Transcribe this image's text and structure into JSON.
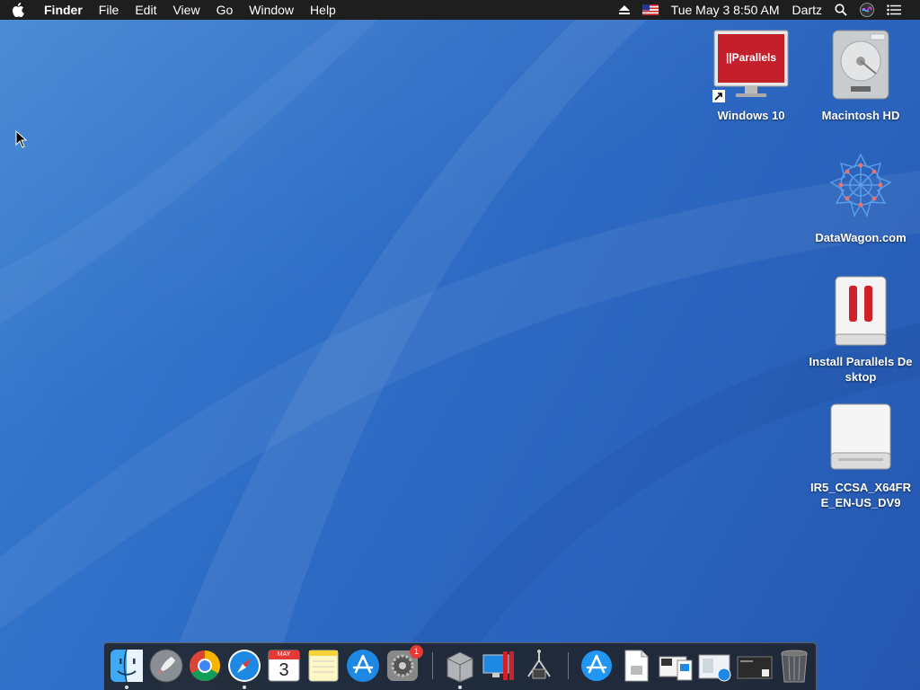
{
  "menubar": {
    "app_name": "Finder",
    "menus": [
      "File",
      "Edit",
      "View",
      "Go",
      "Window",
      "Help"
    ],
    "clock": "Tue May 3  8:50 AM",
    "user": "Dartz"
  },
  "desktop": {
    "icons": [
      {
        "label": "Windows 10",
        "icon": "parallels-vm-icon",
        "brand": "||Parallels"
      },
      {
        "label": "Macintosh HD",
        "icon": "hard-drive-icon"
      },
      {
        "label": "DataWagon.com",
        "icon": "datawagon-icon"
      },
      {
        "label": "Install Parallels Desktop",
        "icon": "parallels-installer-icon"
      },
      {
        "label": "IR5_CCSA_X64FRE_EN-US_DV9",
        "icon": "disk-image-icon"
      }
    ]
  },
  "dock": {
    "apps": [
      {
        "name": "Finder",
        "icon": "finder-icon",
        "running": true
      },
      {
        "name": "Launchpad",
        "icon": "launchpad-icon"
      },
      {
        "name": "Google Chrome",
        "icon": "chrome-icon"
      },
      {
        "name": "Safari",
        "icon": "safari-icon",
        "running": true
      },
      {
        "name": "Calendar",
        "icon": "calendar-icon",
        "month": "MAY",
        "day": "3"
      },
      {
        "name": "Notes",
        "icon": "notes-icon"
      },
      {
        "name": "App Store",
        "icon": "app-store-icon"
      },
      {
        "name": "System Preferences",
        "icon": "system-preferences-icon",
        "badge": "1"
      },
      {
        "name": "Boot Camp Assistant",
        "icon": "boot-camp-icon",
        "running": true
      },
      {
        "name": "Parallels Desktop",
        "icon": "parallels-desktop-icon"
      },
      {
        "name": "Network Utility",
        "icon": "network-utility-icon"
      },
      {
        "name": "Applications",
        "icon": "applications-stack-icon"
      },
      {
        "name": "Document",
        "icon": "document-icon"
      },
      {
        "name": "Downloads",
        "icon": "downloads-stack-icon"
      },
      {
        "name": "Safari Downloads",
        "icon": "safari-downloads-stack-icon"
      },
      {
        "name": "Screenshots",
        "icon": "screenshots-stack-icon"
      },
      {
        "name": "Trash",
        "icon": "trash-icon"
      }
    ]
  },
  "colors": {
    "menubar": "#1e1e1e",
    "desktop": "#2f6fc8",
    "parallels_red": "#d0202a"
  }
}
